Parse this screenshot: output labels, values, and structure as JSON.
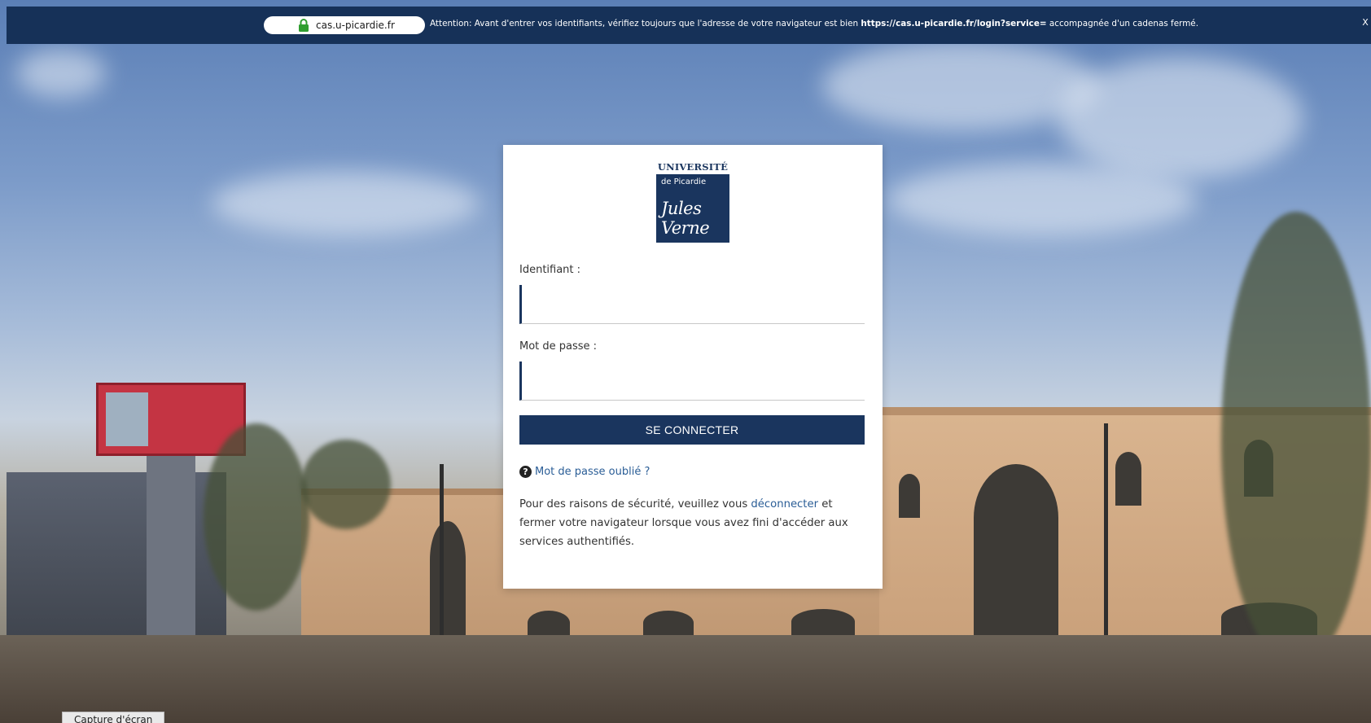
{
  "topbar": {
    "url": "cas.u-picardie.fr",
    "warning_prefix": "Attention: Avant d'entrer vos identifiants, vérifiez toujours que l'adresse de votre navigateur est bien ",
    "warning_url": "https://cas.u-picardie.fr/login?service=",
    "warning_suffix": " accompagnée d'un cadenas fermé.",
    "close_label": "X"
  },
  "logo": {
    "title": "UNIVERSITÉ",
    "subtitle": "de Picardie",
    "signature": "Jules Verne"
  },
  "form": {
    "username_label": "Identifiant :",
    "username_value": "",
    "password_label": "Mot de passe :",
    "password_value": "",
    "submit_label": "SE CONNECTER",
    "forgot_label": "Mot de passe oublié ?"
  },
  "notice": {
    "text_before": "Pour des raisons de sécurité, veuillez vous ",
    "link": "déconnecter",
    "text_after": " et fermer votre navigateur lorsque vous avez fini d'accéder aux services authentifiés."
  },
  "capture_chip": "Capture d'écran",
  "colors": {
    "brand": "#1a355e",
    "link": "#2a5d96",
    "topbar": "#163158"
  },
  "icons": {
    "lock": "lock-icon",
    "help": "question-circle-icon",
    "close": "close-icon"
  }
}
